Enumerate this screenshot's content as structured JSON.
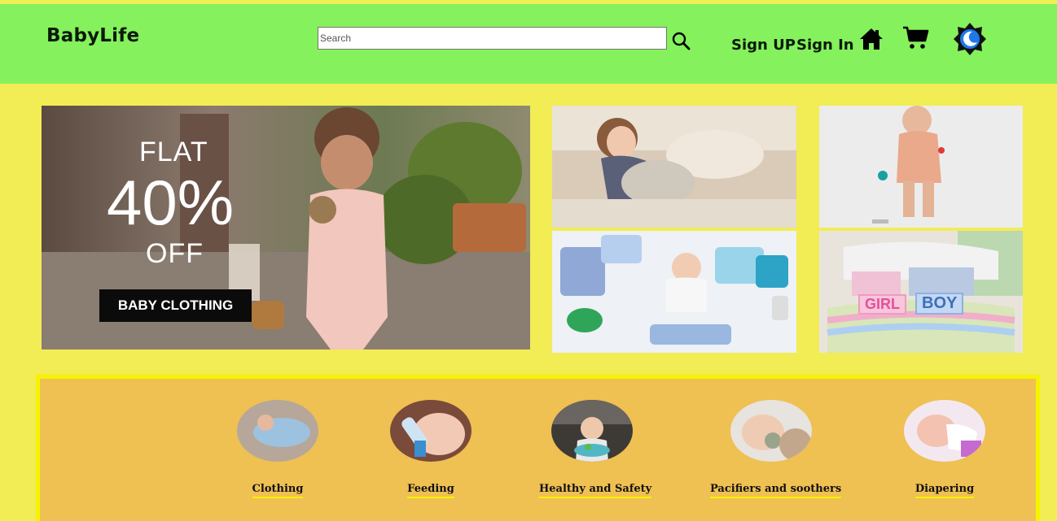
{
  "brand": {
    "name": "BabyLife"
  },
  "search": {
    "placeholder": "Search"
  },
  "nav": {
    "sign_up": "Sign UP",
    "sign_in": "Sign In",
    "home_icon": "home-icon",
    "cart_icon": "cart-icon",
    "theme_icon": "moon-badge-icon"
  },
  "hero": {
    "line1": "FLAT",
    "line2": "40%",
    "line3": "OFF",
    "cta": "BABY CLOTHING"
  },
  "gallery": {
    "tile_boy_text": "BOY",
    "tile_girl_text": "GIRL"
  },
  "categories": [
    {
      "label": "Clothing"
    },
    {
      "label": "Feeding"
    },
    {
      "label": "Healthy and Safety"
    },
    {
      "label": "Pacifiers and soothers"
    },
    {
      "label": "Diapering"
    }
  ],
  "colors": {
    "page_bg": "#f2ec55",
    "header_bg": "#85f15c",
    "panel_bg": "#efc052",
    "panel_border": "#f6f300"
  }
}
